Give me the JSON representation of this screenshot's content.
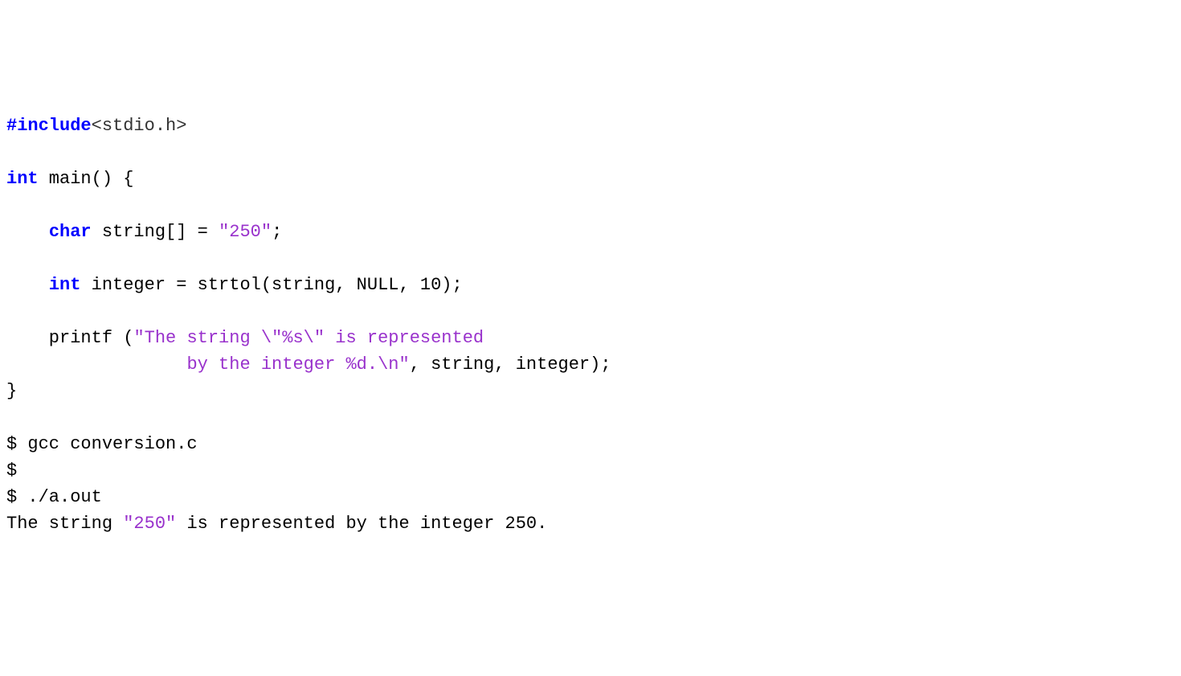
{
  "code": {
    "line1_include": "#include",
    "line1_header": "<stdio.h>",
    "line3_int": "int",
    "line3_rest": " main() {",
    "line5_indent": "    ",
    "line5_char": "char",
    "line5_mid": " string[] = ",
    "line5_str": "\"250\"",
    "line5_end": ";",
    "line7_indent": "    ",
    "line7_int": "int",
    "line7_rest": " integer = strtol(string, NULL, 10);",
    "line9a": "    printf (",
    "line9_str1": "\"The string \\\"%s\\\" is represented",
    "line10_indent": "                 ",
    "line10_str2": "by the integer %d.\\n\"",
    "line10_rest": ", string, integer);",
    "line11": "}",
    "blank": "",
    "line13": "$ gcc conversion.c",
    "line14": "$",
    "line15": "$ ./a.out",
    "line16a": "The string ",
    "line16_str": "\"250\"",
    "line16b": " is represented by the integer 250."
  }
}
